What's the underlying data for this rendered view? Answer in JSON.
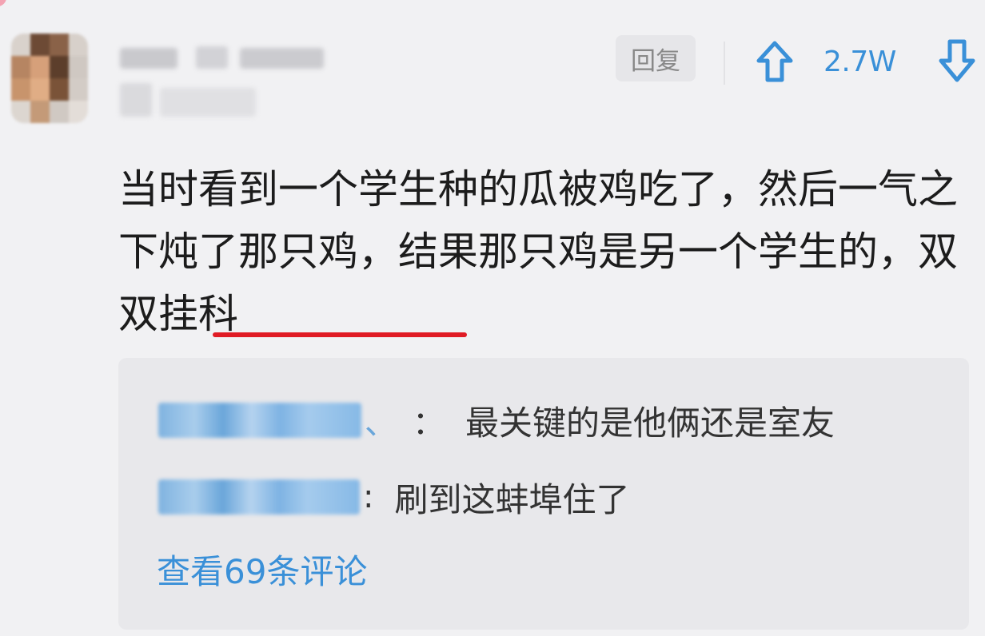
{
  "comment": {
    "reply_label": "回复",
    "upvote_icon": "arrow-up-icon",
    "downvote_icon": "arrow-down-icon",
    "vote_count": "2.7W",
    "text_part1": "当时看到一个学生种的瓜被鸡吃了，然后一气之下炖了那只鸡，结果那只鸡是另一个学生的，",
    "text_highlight": "双双挂科"
  },
  "replies": [
    {
      "suffix": "、",
      "colon": "：",
      "text": "最关键的是他俩还是室友"
    },
    {
      "suffix": "",
      "colon": ":",
      "text": "刷到这蚌埠住了"
    }
  ],
  "view_more_label": "查看69条评论",
  "colors": {
    "accent": "#3a90d8",
    "underline": "#e01b24",
    "background": "#f1f1f3",
    "reply_box": "#e8e8eb"
  }
}
